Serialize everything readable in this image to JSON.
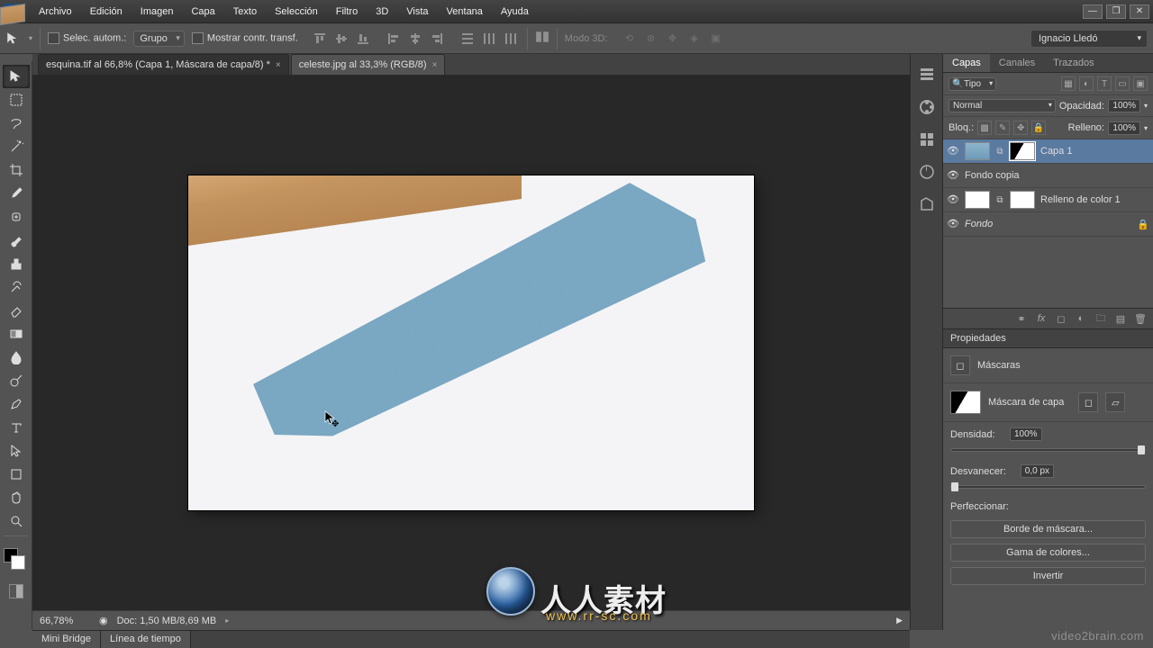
{
  "menu": [
    "Archivo",
    "Edición",
    "Imagen",
    "Capa",
    "Texto",
    "Selección",
    "Filtro",
    "3D",
    "Vista",
    "Ventana",
    "Ayuda"
  ],
  "options": {
    "autoSelect": "Selec. autom.:",
    "group": "Grupo",
    "showTransform": "Mostrar contr. transf.",
    "mode3d": "Modo 3D:"
  },
  "workspace": "Ignacio Lledó",
  "tabs": [
    {
      "label": "esquina.tif al 66,8% (Capa 1, Máscara de capa/8) *"
    },
    {
      "label": "celeste.jpg al 33,3% (RGB/8)"
    }
  ],
  "status": {
    "zoom": "66,78%",
    "doc": "Doc: 1,50 MB/8,69 MB"
  },
  "layersPanel": {
    "tabs": [
      "Capas",
      "Canales",
      "Trazados"
    ],
    "kind": "Tipo",
    "blend": "Normal",
    "opacityLabel": "Opacidad:",
    "opacity": "100%",
    "lockLabel": "Bloq.:",
    "fillLabel": "Relleno:",
    "fill": "100%",
    "layers": [
      {
        "name": "Capa 1"
      },
      {
        "name": "Fondo copia"
      },
      {
        "name": "Relleno de color 1"
      },
      {
        "name": "Fondo"
      }
    ]
  },
  "props": {
    "title": "Propiedades",
    "masks": "Máscaras",
    "layerMask": "Máscara de capa",
    "density": "Densidad:",
    "densityVal": "100%",
    "feather": "Desvanecer:",
    "featherVal": "0,0 px",
    "refine": "Perfeccionar:",
    "btnEdge": "Borde de máscara...",
    "btnRange": "Gama de colores...",
    "btnInvert": "Invertir"
  },
  "bottomTabs": [
    "Mini Bridge",
    "Línea de tiempo"
  ],
  "watermark": {
    "text": "人人素材",
    "sub": "www.rr-sc.com",
    "right": "video2brain.com"
  }
}
